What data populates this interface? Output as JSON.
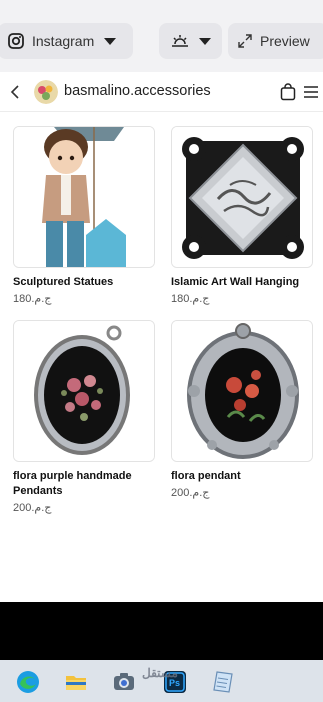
{
  "toolbar": {
    "platform_label": "Instagram",
    "preview_label": "Preview"
  },
  "shop": {
    "name": "basmalino.accessories"
  },
  "products": [
    {
      "name": "Sculptured Statues",
      "price": "ج.م.180"
    },
    {
      "name": "Islamic Art Wall Hanging",
      "price": "ج.م.180"
    },
    {
      "name": "flora purple handmade Pendants",
      "price": "ج.م.200"
    },
    {
      "name": "flora pendant",
      "price": "ج.م.200"
    }
  ],
  "watermark": "مستقل",
  "icons": {
    "platform": "instagram-icon",
    "theme": "sunrise-icon",
    "preview": "expand-icon",
    "back": "chevron-left-icon",
    "bag": "shopping-bag-icon",
    "menu": "hamburger-menu-icon"
  },
  "colors": {
    "toolbar_bg": "#f2f2f4",
    "pill_bg": "#e6e6ea",
    "taskbar_bg": "#dde3ea"
  }
}
